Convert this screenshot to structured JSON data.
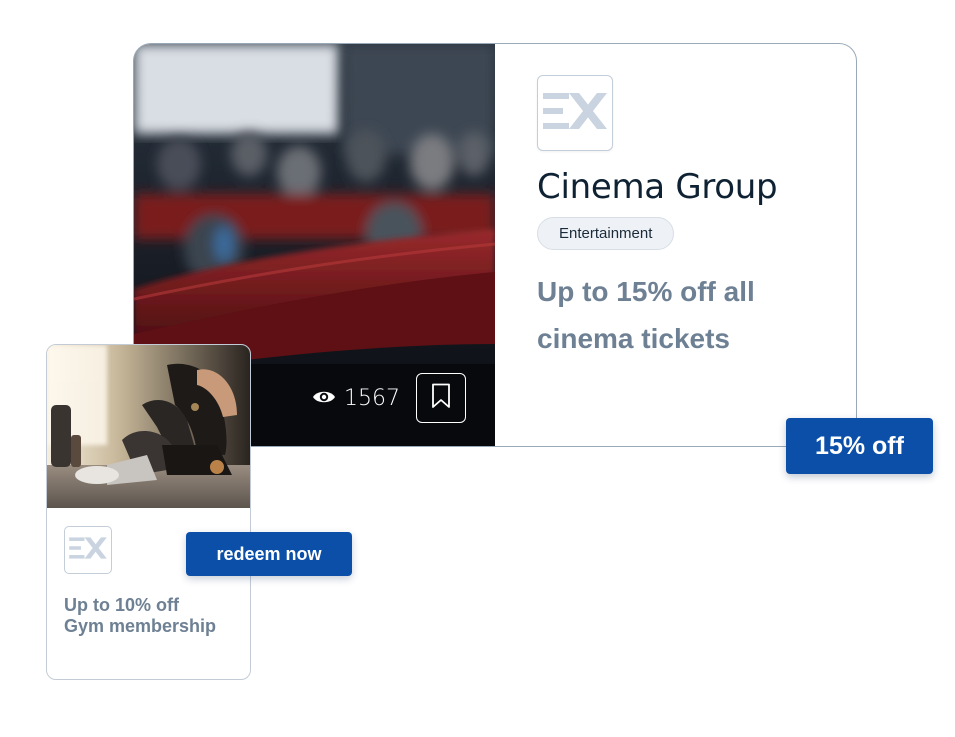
{
  "cinema_offer": {
    "brand_name": "Cinema Group",
    "category": "Entertainment",
    "offer_text": "Up to 15% off all cinema tickets",
    "view_count": "1567",
    "discount_badge": "15% off",
    "icons": {
      "views": "eye-icon",
      "bookmark": "bookmark-icon",
      "logo": "ex-logo-icon"
    }
  },
  "gym_offer": {
    "offer_line1": "Up to 10% off",
    "offer_line2": "Gym membership",
    "redeem_label": "redeem now",
    "icons": {
      "logo": "ex-logo-icon"
    }
  },
  "colors": {
    "primary_button": "#0b4fa8",
    "offer_text": "#6e8093",
    "brand_text": "#0f2233",
    "tag_background": "#eef2f6"
  }
}
